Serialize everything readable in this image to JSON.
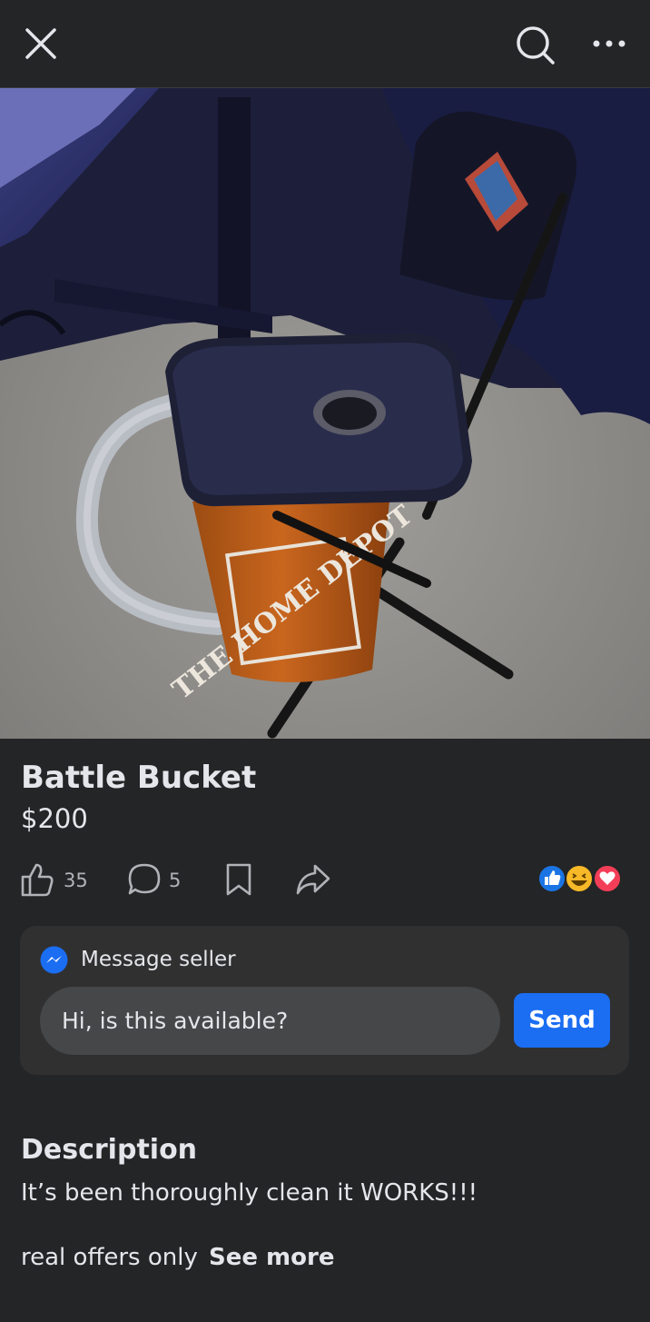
{
  "header": {
    "close_icon": "close-icon",
    "search_icon": "search-icon",
    "more_icon": "more-options-icon"
  },
  "listing": {
    "title": "Battle Bucket",
    "price": "$200",
    "bucket_print": "THE HOME DEPOT"
  },
  "actions": {
    "like_count": "35",
    "comment_count": "5",
    "icons": [
      "thumbs-up-icon",
      "comment-icon",
      "bookmark-icon",
      "share-icon"
    ],
    "reactions": [
      "like",
      "haha",
      "love"
    ]
  },
  "message": {
    "heading": "Message seller",
    "input_value": "Hi, is this available?",
    "send_label": "Send"
  },
  "description": {
    "heading": "Description",
    "line1": "It’s been thoroughly clean it WORKS!!!",
    "line2": "real offers only",
    "see_more": "See more"
  },
  "colors": {
    "background": "#242526",
    "card": "#303031",
    "input": "#464748",
    "accent": "#1b6ef2",
    "text": "#e4e6eb"
  }
}
